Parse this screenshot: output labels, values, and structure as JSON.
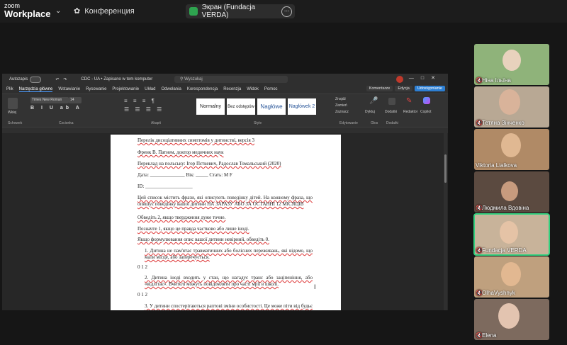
{
  "app": {
    "brand_small": "zoom",
    "brand_big": "Workplace",
    "conference_label": "Конференция",
    "screen_pill": "Экран (Fundacja VERDA)"
  },
  "word": {
    "autosave": "Autozapis",
    "doc_title": "CDC - UA • Zapisano w tem komputer",
    "search_placeholder": "Wyszukaj",
    "tabs": [
      "Plik",
      "Narzędzia główne",
      "Wstawianie",
      "Rysowanie",
      "Projektowanie",
      "Układ",
      "Odwołania",
      "Korespondencja",
      "Recenzja",
      "Widok",
      "Pomoc"
    ],
    "right_buttons": [
      "Komentarze",
      "Edycja",
      "Udostępnianie"
    ],
    "font": "Times New Roman",
    "size": "14",
    "styles": [
      "Normalny",
      "Bez odstępów",
      "Nagłówe",
      "Nagłówek 2"
    ],
    "groups": [
      "Schowek",
      "Czcionka",
      "Akapit",
      "Style",
      "Edytowanie",
      "Głos",
      "Dodatki"
    ],
    "editing": [
      "Znajdź",
      "Zamień",
      "Zaznacz"
    ],
    "paste": "Wklej",
    "dictate": "Dyktuj",
    "addins": "Dodatki",
    "editor": "Redaktor",
    "copilot": "Copilot"
  },
  "doc": {
    "l1": "Перелік дисоціативних симптомів у дитинстві, версія 3",
    "l2": "Френк В. Патнем, доктор медичних наук",
    "l3": "Переклад на польську: Ігор Пєткевич, Радослав Томальський (2020)",
    "l4": "Дата: ______________ Вік: _____ Стать: М F",
    "l5": "ID: ___________________",
    "l6": "Цей список містить фрази, які описують поведінку дітей. На кожному фраза, що опишує поведінку вашої дитини НА ЗАРАЗУ АБО ЗА ОСТАННІ 12 МІСЯЦІВ",
    "l7": "Обведіть 2, якщо твердження дуже точне.",
    "l8": "Позначте 1, якщо це правда частково або лише іноді.",
    "l9": "Якщо формулювання опис вашої дитини невірний, обведіть 0.",
    "i1": "1.   Дитина не пам'ятає травматичних або болісних переживань, які відомо, що мали місце, або заперечується.",
    "s1": "0 1 2",
    "i2": "2.   Дитина іноді входить у стан, що нагадує транс або заціпеніння, або «відлітає». Вчителі можуть повідомляти про часті мрії в школі.",
    "s2": "0 1 2",
    "i3": "3.   У дитини спостерігаються раптові зміни особистості. Це може піти від будьє сором'язливої до комунікабельної, від жіночності до мужності,"
  },
  "participants": [
    {
      "name": "Ніна Ільїна",
      "muted": true,
      "bg": "#8fb37a"
    },
    {
      "name": "Тетяна Зінченко",
      "muted": true,
      "bg": "#b8a894"
    },
    {
      "name": "Viktoria Lialkova",
      "muted": false,
      "bg": "#b08a66"
    },
    {
      "name": "Людмила Вдовіна",
      "muted": true,
      "bg": "#5b4a40"
    },
    {
      "name": "Fundacja VERDA",
      "muted": true,
      "bg": "#c8b39a"
    },
    {
      "name": "OlhaVyshnyk",
      "muted": true,
      "bg": "#bfa07e"
    },
    {
      "name": "Elena",
      "muted": true,
      "bg": "#7d6a5e"
    }
  ]
}
